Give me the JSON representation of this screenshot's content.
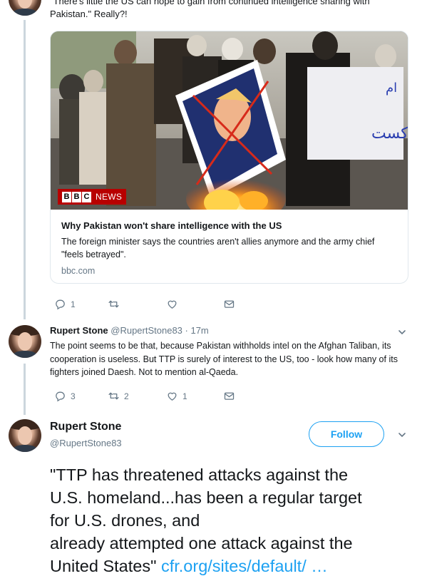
{
  "tweet1": {
    "text_top": "\"There's little the US can hope to gain from continued intelligence sharing with",
    "text_bottom": "Pakistan.\" Really?!",
    "card": {
      "badge_box1": "B",
      "badge_box2": "B",
      "badge_box3": "C",
      "badge_news": "NEWS",
      "title": "Why Pakistan won't share intelligence with the US",
      "description": "The foreign minister says the countries aren't allies anymore and the army chief \"feels betrayed\".",
      "domain": "bbc.com"
    },
    "actions": {
      "replies": "1",
      "retweets": "",
      "likes": ""
    }
  },
  "tweet2": {
    "name": "Rupert Stone",
    "handle": "@RupertStone83",
    "time": "· 17m",
    "text": "The point seems to be that, because Pakistan withholds intel on the Afghan Taliban, its cooperation is useless. But TTP is surely of interest to the US, too - look how many of its fighters joined Daesh. Not to mention al-Qaeda.",
    "actions": {
      "replies": "3",
      "retweets": "2",
      "likes": "1"
    }
  },
  "tweet3": {
    "name": "Rupert Stone",
    "handle": "@RupertStone83",
    "follow_label": "Follow",
    "lines": [
      "\"TTP has threatened attacks against the",
      "U.S. homeland...has been a regular target",
      "for U.S. drones, and",
      "already attempted one attack against the"
    ],
    "last_line": "United States\"",
    "link": "cfr.org/sites/default/ …"
  },
  "colors": {
    "accent": "#1da1f2",
    "muted": "#657786",
    "thread_line": "#ccd6dd",
    "bbc_red": "#b80000"
  },
  "icons": {
    "reply": "reply-icon",
    "retweet": "retweet-icon",
    "like": "heart-icon",
    "dm": "envelope-icon",
    "menu": "chevron-down-icon"
  }
}
